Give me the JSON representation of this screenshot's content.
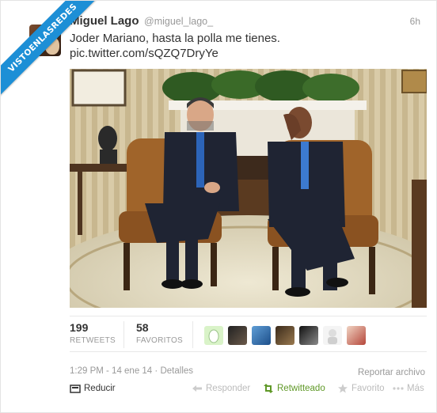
{
  "watermark": "VISTOENLASREDES",
  "tweet": {
    "name": "Miguel Lago",
    "handle": "@miguel_lago_",
    "age": "6h",
    "text": "Joder Mariano, hasta la polla me tienes.",
    "link": "pic.twitter.com/sQZQ7DryYe"
  },
  "stats": {
    "retweets_count": "199",
    "retweets_label": "RETWEETS",
    "favorites_count": "58",
    "favorites_label": "FAVORITOS"
  },
  "footer": {
    "timestamp": "1:29 PM - 14 ene 14",
    "separator": "·",
    "details": "Detalles",
    "report": "Reportar archivo"
  },
  "actions": {
    "collapse": "Reducir",
    "reply": "Responder",
    "retweeted": "Retwitteado",
    "favorite": "Favorito",
    "more": "Más"
  },
  "colors": {
    "ribbon": "#1d8fd6",
    "retweeted_green": "#609928",
    "text": "#333333",
    "muted": "#999999"
  },
  "icons": [
    "expand-collapse-icon",
    "reply-icon",
    "retweet-icon",
    "star-icon",
    "more-dots-icon"
  ]
}
